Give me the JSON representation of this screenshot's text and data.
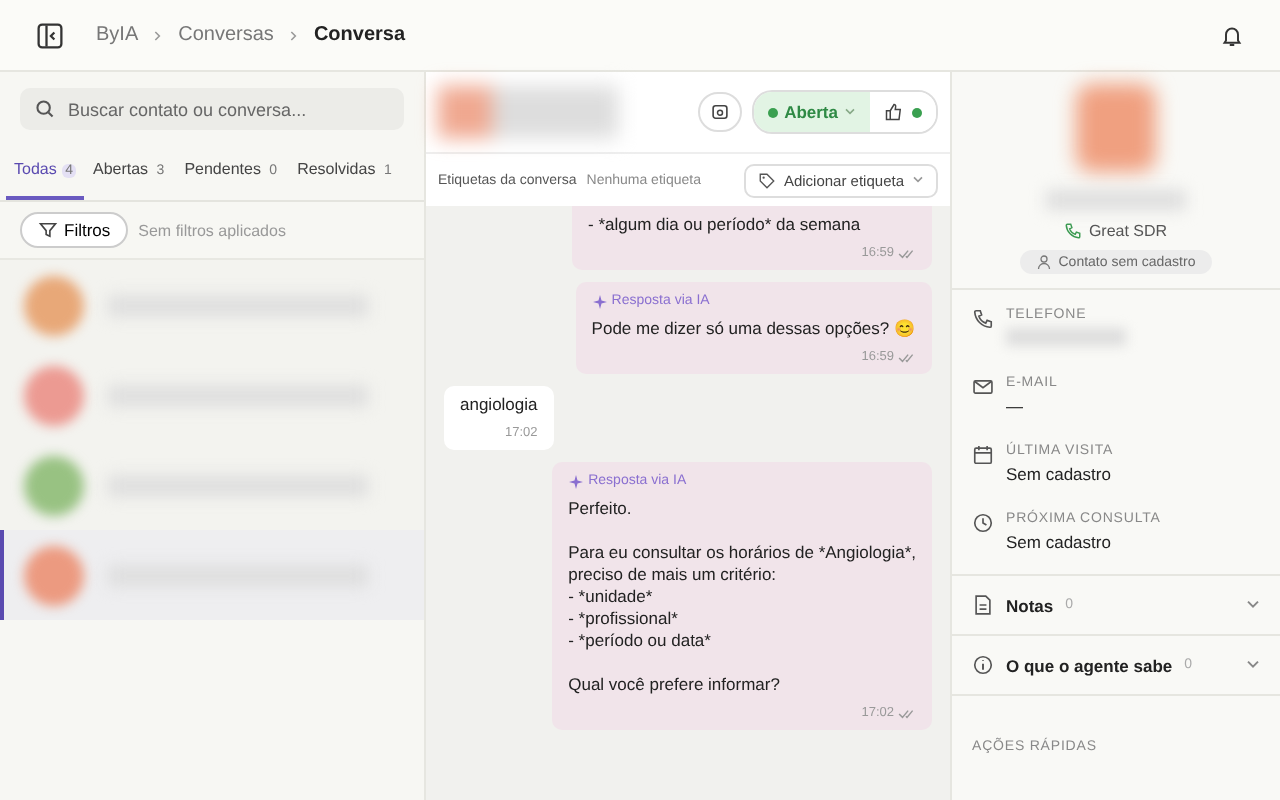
{
  "breadcrumb": [
    {
      "label": "ByIA",
      "current": false
    },
    {
      "label": "Conversas",
      "current": false
    },
    {
      "label": "Conversa",
      "current": true
    }
  ],
  "search": {
    "placeholder": "Buscar contato ou conversa..."
  },
  "tabs": [
    {
      "label": "Todas",
      "count": "4",
      "selected": true
    },
    {
      "label": "Abertas",
      "count": "3",
      "selected": false
    },
    {
      "label": "Pendentes",
      "count": "0",
      "selected": false
    },
    {
      "label": "Resolvidas",
      "count": "1",
      "selected": false
    }
  ],
  "filters": {
    "button": "Filtros",
    "note": "Sem filtros aplicados"
  },
  "conversations": [
    {
      "color": "#e8a878",
      "selected": false
    },
    {
      "color": "#ec9a92",
      "selected": false
    },
    {
      "color": "#98c282",
      "selected": false
    },
    {
      "color": "#ec9a80",
      "selected": true
    }
  ],
  "chat_header": {
    "status": "Aberta",
    "status_on": true
  },
  "tags": {
    "label": "Etiquetas da conversa",
    "empty": "Nenhuma etiqueta",
    "add_button": "Adicionar etiqueta"
  },
  "messages": [
    {
      "kind": "outgoing",
      "ai": false,
      "text": "- *algum dia ou período* da semana",
      "time": "16:59"
    },
    {
      "kind": "outgoing",
      "ai": true,
      "ai_label": "Resposta via IA",
      "text": "Pode me dizer só uma dessas opções? 😊",
      "time": "16:59"
    },
    {
      "kind": "incoming",
      "text": "angiologia",
      "time": "17:02"
    },
    {
      "kind": "outgoing",
      "ai": true,
      "ai_label": "Resposta via IA",
      "text": "Perfeito.\n\nPara eu consultar os horários de *Angiologia*,\npreciso de mais um critério:\n- *unidade*\n- *profissional*\n- *período ou data*\n\nQual você prefere informar?",
      "time": "17:02"
    }
  ],
  "contact": {
    "role": "Great SDR",
    "badge": "Contato sem cadastro"
  },
  "fields": [
    {
      "kind": "phone",
      "label": "TELEFONE"
    },
    {
      "kind": "mail",
      "label": "E-MAIL",
      "value": "—"
    },
    {
      "kind": "calendar",
      "label": "ÚLTIMA VISITA",
      "value": "Sem cadastro"
    },
    {
      "kind": "clock",
      "label": "PRÓXIMA CONSULTA",
      "value": "Sem cadastro"
    }
  ],
  "sections": [
    {
      "kind": "notes",
      "label": "Notas",
      "count": "0",
      "expanded": false
    },
    {
      "kind": "info",
      "label": "O que o agente sabe",
      "count": "0",
      "expanded": false
    }
  ],
  "quick_actions": {
    "label": "AÇÕES RÁPIDAS"
  }
}
